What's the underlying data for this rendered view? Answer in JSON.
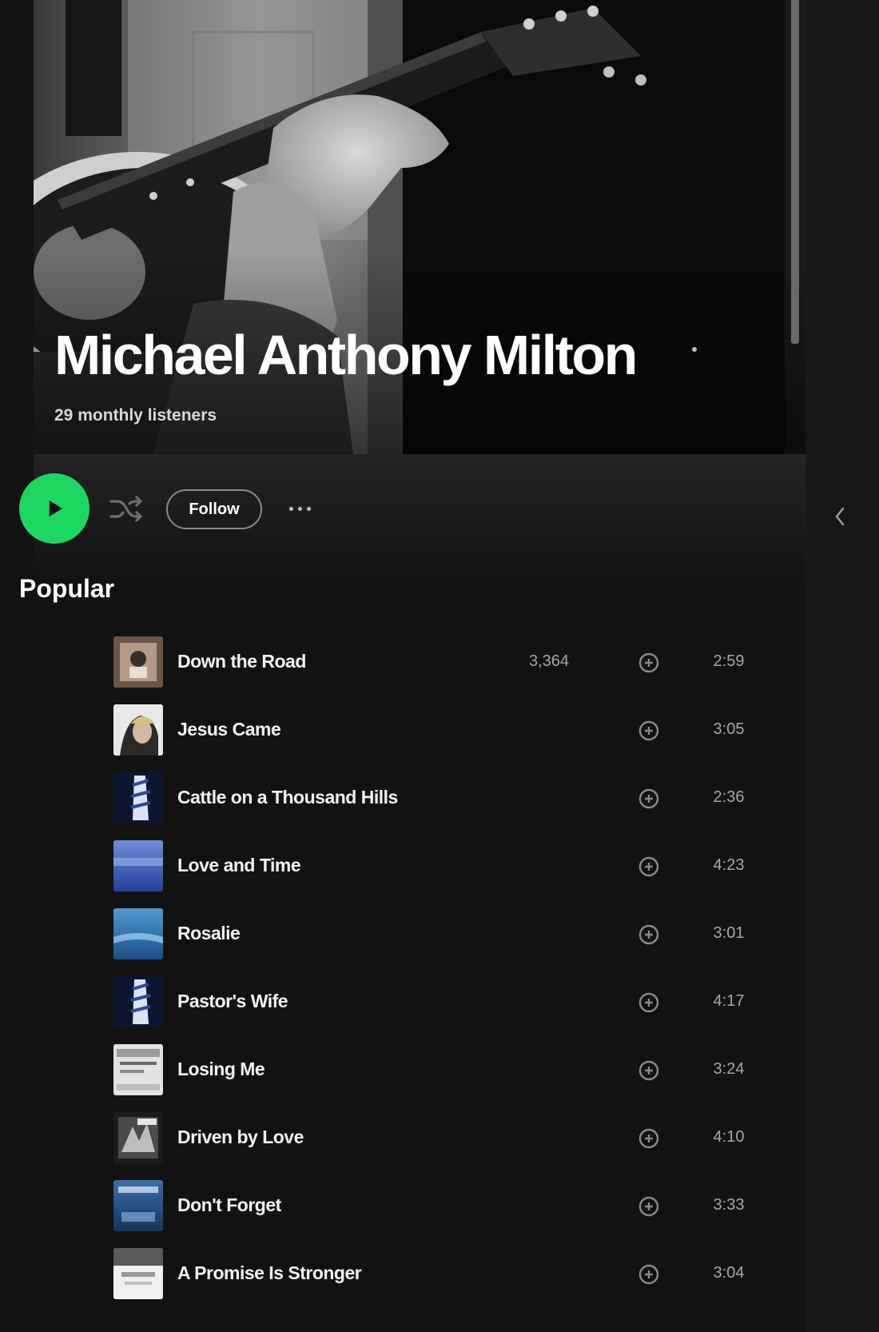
{
  "artist": {
    "name": "Michael Anthony Milton",
    "monthly_listeners": "29 monthly listeners"
  },
  "actions": {
    "follow_label": "Follow"
  },
  "popular": {
    "heading": "Popular",
    "tracks": [
      {
        "title": "Down the Road",
        "plays": "3,364",
        "duration": "2:59"
      },
      {
        "title": "Jesus Came",
        "plays": "",
        "duration": "3:05"
      },
      {
        "title": "Cattle on a Thousand Hills",
        "plays": "",
        "duration": "2:36"
      },
      {
        "title": "Love and Time",
        "plays": "",
        "duration": "4:23"
      },
      {
        "title": "Rosalie",
        "plays": "",
        "duration": "3:01"
      },
      {
        "title": "Pastor's Wife",
        "plays": "",
        "duration": "4:17"
      },
      {
        "title": "Losing Me",
        "plays": "",
        "duration": "3:24"
      },
      {
        "title": "Driven by Love",
        "plays": "",
        "duration": "4:10"
      },
      {
        "title": "Don't Forget",
        "plays": "",
        "duration": "3:33"
      },
      {
        "title": "A Promise Is Stronger",
        "plays": "",
        "duration": "3:04"
      }
    ]
  },
  "icons": {
    "play": "play-icon",
    "shuffle": "shuffle-icon",
    "more": "more-options-icon",
    "add": "add-circle-icon",
    "collapse": "chevron-left-icon"
  },
  "colors": {
    "accent": "#1ed760",
    "background": "#121212",
    "text_secondary": "#a7a7a7"
  }
}
